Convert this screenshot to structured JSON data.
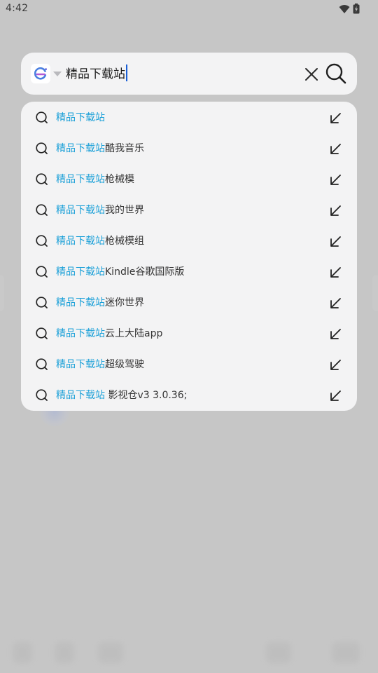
{
  "status_bar": {
    "time": "4:42",
    "icons": [
      "wifi-icon",
      "battery-icon"
    ]
  },
  "colors": {
    "highlight": "#1ba0d8",
    "caret": "#1a5fd6",
    "panel_bg": "#f3f3f4",
    "scrim": "#c6c6c6"
  },
  "search_bar": {
    "engine_icon": "browser-logo-icon",
    "query": "精品下载站",
    "clear_icon": "close-icon",
    "search_icon": "search-icon"
  },
  "suggestions": [
    {
      "match": "精品下载站",
      "rest": ""
    },
    {
      "match": "精品下载站",
      "rest": "酷我音乐"
    },
    {
      "match": "精品下载站",
      "rest": "枪械模"
    },
    {
      "match": "精品下载站",
      "rest": "我的世界"
    },
    {
      "match": "精品下载站",
      "rest": "枪械模组"
    },
    {
      "match": "精品下载站",
      "rest": "Kindle谷歌国际版"
    },
    {
      "match": "精品下载站",
      "rest": "迷你世界"
    },
    {
      "match": "精品下载站",
      "rest": "云上大陆app"
    },
    {
      "match": "精品下载站",
      "rest": "超级驾驶"
    },
    {
      "match": "精品下载站",
      "rest": " 影视仓v3 3.0.36;"
    }
  ]
}
